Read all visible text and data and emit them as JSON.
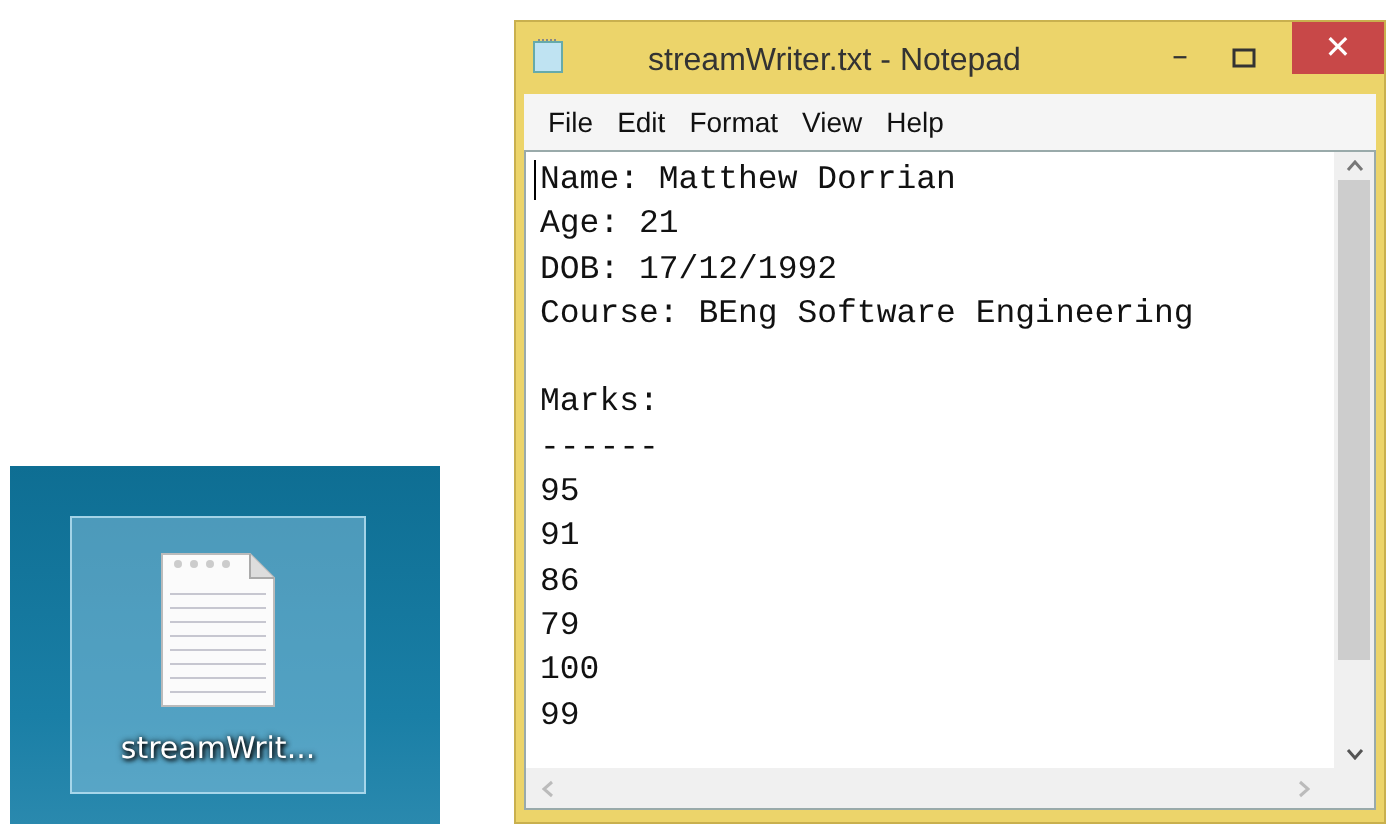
{
  "desktop_icon": {
    "label": "streamWrit...",
    "selected": true
  },
  "window": {
    "title": "streamWriter.txt - Notepad",
    "controls": {
      "minimize": "–",
      "close": "✕"
    }
  },
  "menu": [
    "File",
    "Edit",
    "Format",
    "View",
    "Help"
  ],
  "document": {
    "paragraphs": [
      {
        "lines": [
          "Name: Matthew Dorrian",
          "Age: 21",
          "DOB: 17/12/1992",
          "Course: BEng Software Engineering"
        ]
      },
      {
        "lines": [
          "Marks:",
          "------",
          "95",
          "91",
          "86",
          "79",
          "100",
          "99"
        ]
      }
    ]
  }
}
